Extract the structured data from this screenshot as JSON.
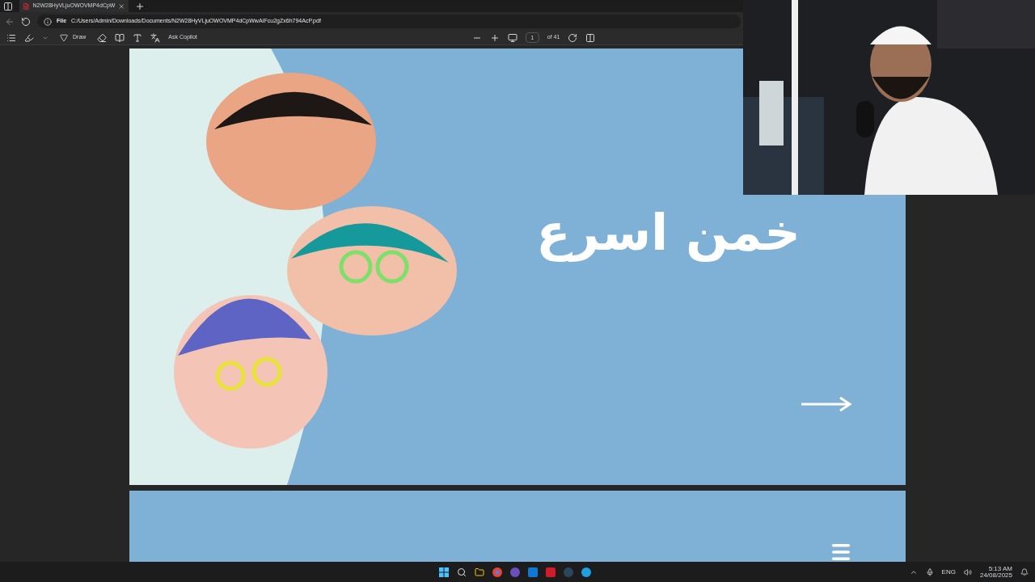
{
  "tab": {
    "title": "N2W28HyVLjuOWOVMP4dCpW"
  },
  "address": {
    "scheme": "File",
    "path": "C:/Users/Admin/Downloads/Documents/N2W28HyVLjuOWOVMP4dCpWwAIFcu2gZx6h794AcP.pdf"
  },
  "toolbar": {
    "draw": "Draw",
    "copilot": "Ask Copilot",
    "page": "1",
    "page_count": "of 41"
  },
  "slide": {
    "title": "خمن اسرع"
  },
  "taskbar": {
    "language": "ENG",
    "time": "5:13 AM",
    "date": "24/08/2025"
  }
}
